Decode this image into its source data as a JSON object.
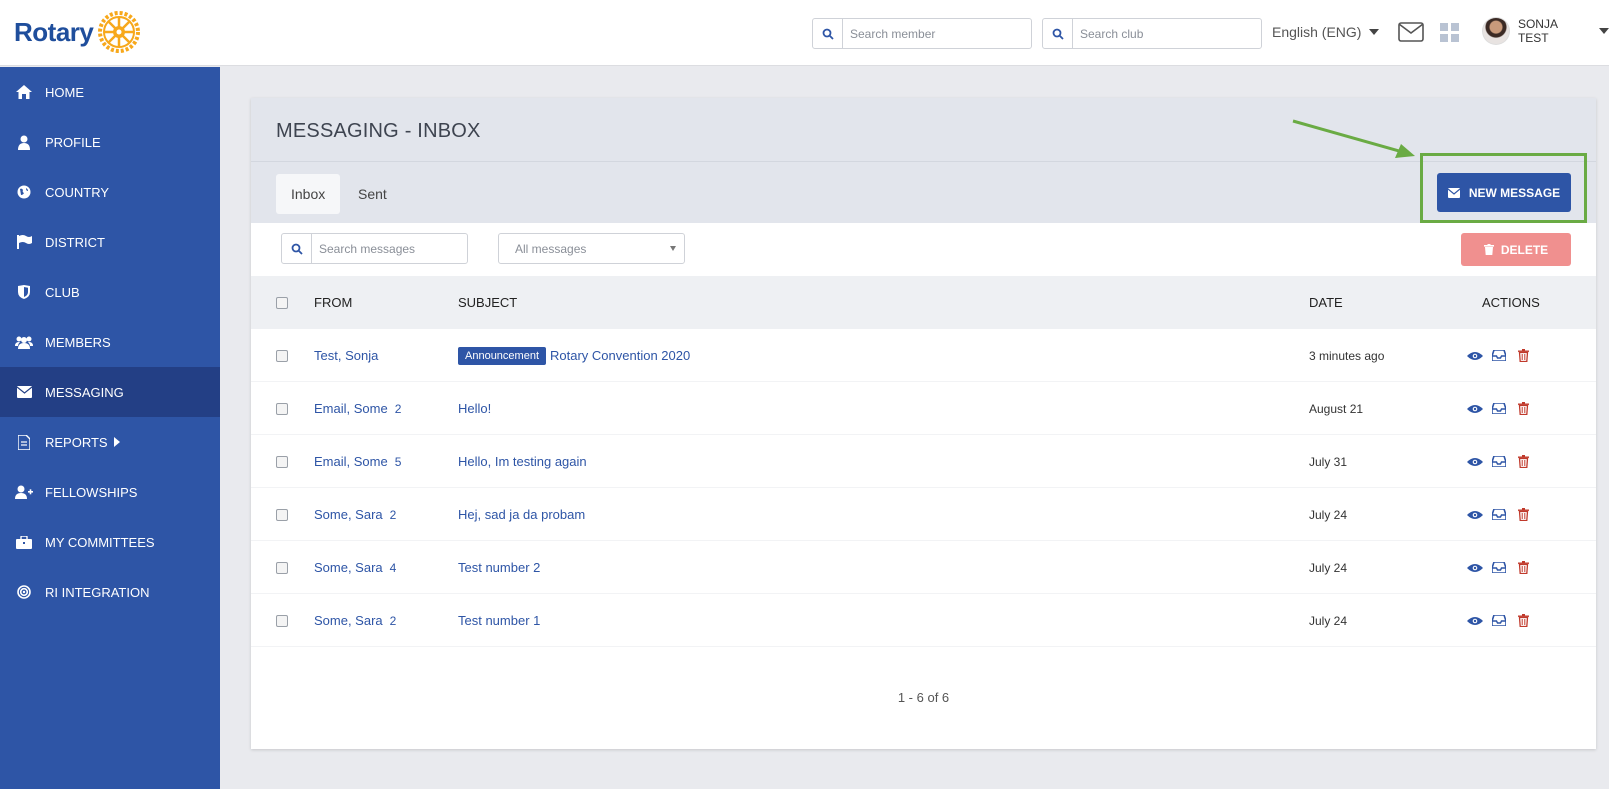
{
  "brand": {
    "name": "Rotary",
    "accent": "#2e55a6",
    "highlight": "#6aab44"
  },
  "header": {
    "search_member_placeholder": "Search member",
    "search_club_placeholder": "Search club",
    "language": "English (ENG)",
    "user_name": "SONJA TEST"
  },
  "sidebar": {
    "items": [
      {
        "label": "HOME",
        "icon": "home-icon"
      },
      {
        "label": "PROFILE",
        "icon": "user-icon"
      },
      {
        "label": "COUNTRY",
        "icon": "globe-icon"
      },
      {
        "label": "DISTRICT",
        "icon": "flag-icon"
      },
      {
        "label": "CLUB",
        "icon": "shield-icon"
      },
      {
        "label": "MEMBERS",
        "icon": "users-icon"
      },
      {
        "label": "MESSAGING",
        "icon": "envelope-icon",
        "active": true
      },
      {
        "label": "REPORTS",
        "icon": "document-icon"
      },
      {
        "label": "FELLOWSHIPS",
        "icon": "user-plus-icon"
      },
      {
        "label": "MY COMMITTEES",
        "icon": "briefcase-icon"
      },
      {
        "label": "RI INTEGRATION",
        "icon": "target-icon"
      }
    ]
  },
  "page": {
    "title": "MESSAGING - INBOX",
    "tabs": [
      {
        "label": "Inbox",
        "active": true
      },
      {
        "label": "Sent"
      }
    ],
    "new_message_label": "NEW MESSAGE",
    "search_messages_placeholder": "Search messages",
    "filter_selected": "All messages",
    "delete_label": "DELETE"
  },
  "table": {
    "columns": {
      "from": "FROM",
      "subject": "SUBJECT",
      "date": "DATE",
      "actions": "ACTIONS"
    },
    "rows": [
      {
        "from": "Test, Sonja",
        "count": "",
        "badge": "Announcement",
        "subject": "Rotary Convention 2020",
        "date": "3 minutes ago"
      },
      {
        "from": "Email, Some",
        "count": "2",
        "badge": "",
        "subject": "Hello!",
        "date": "August 21"
      },
      {
        "from": "Email, Some",
        "count": "5",
        "badge": "",
        "subject": "Hello, Im testing again",
        "date": "July 31"
      },
      {
        "from": "Some, Sara",
        "count": "2",
        "badge": "",
        "subject": "Hej, sad ja da probam",
        "date": "July 24"
      },
      {
        "from": "Some, Sara",
        "count": "4",
        "badge": "",
        "subject": "Test number 2",
        "date": "July 24"
      },
      {
        "from": "Some, Sara",
        "count": "2",
        "badge": "",
        "subject": "Test number 1",
        "date": "July 24"
      }
    ]
  },
  "pagination": {
    "text": "1 - 6 of 6"
  }
}
